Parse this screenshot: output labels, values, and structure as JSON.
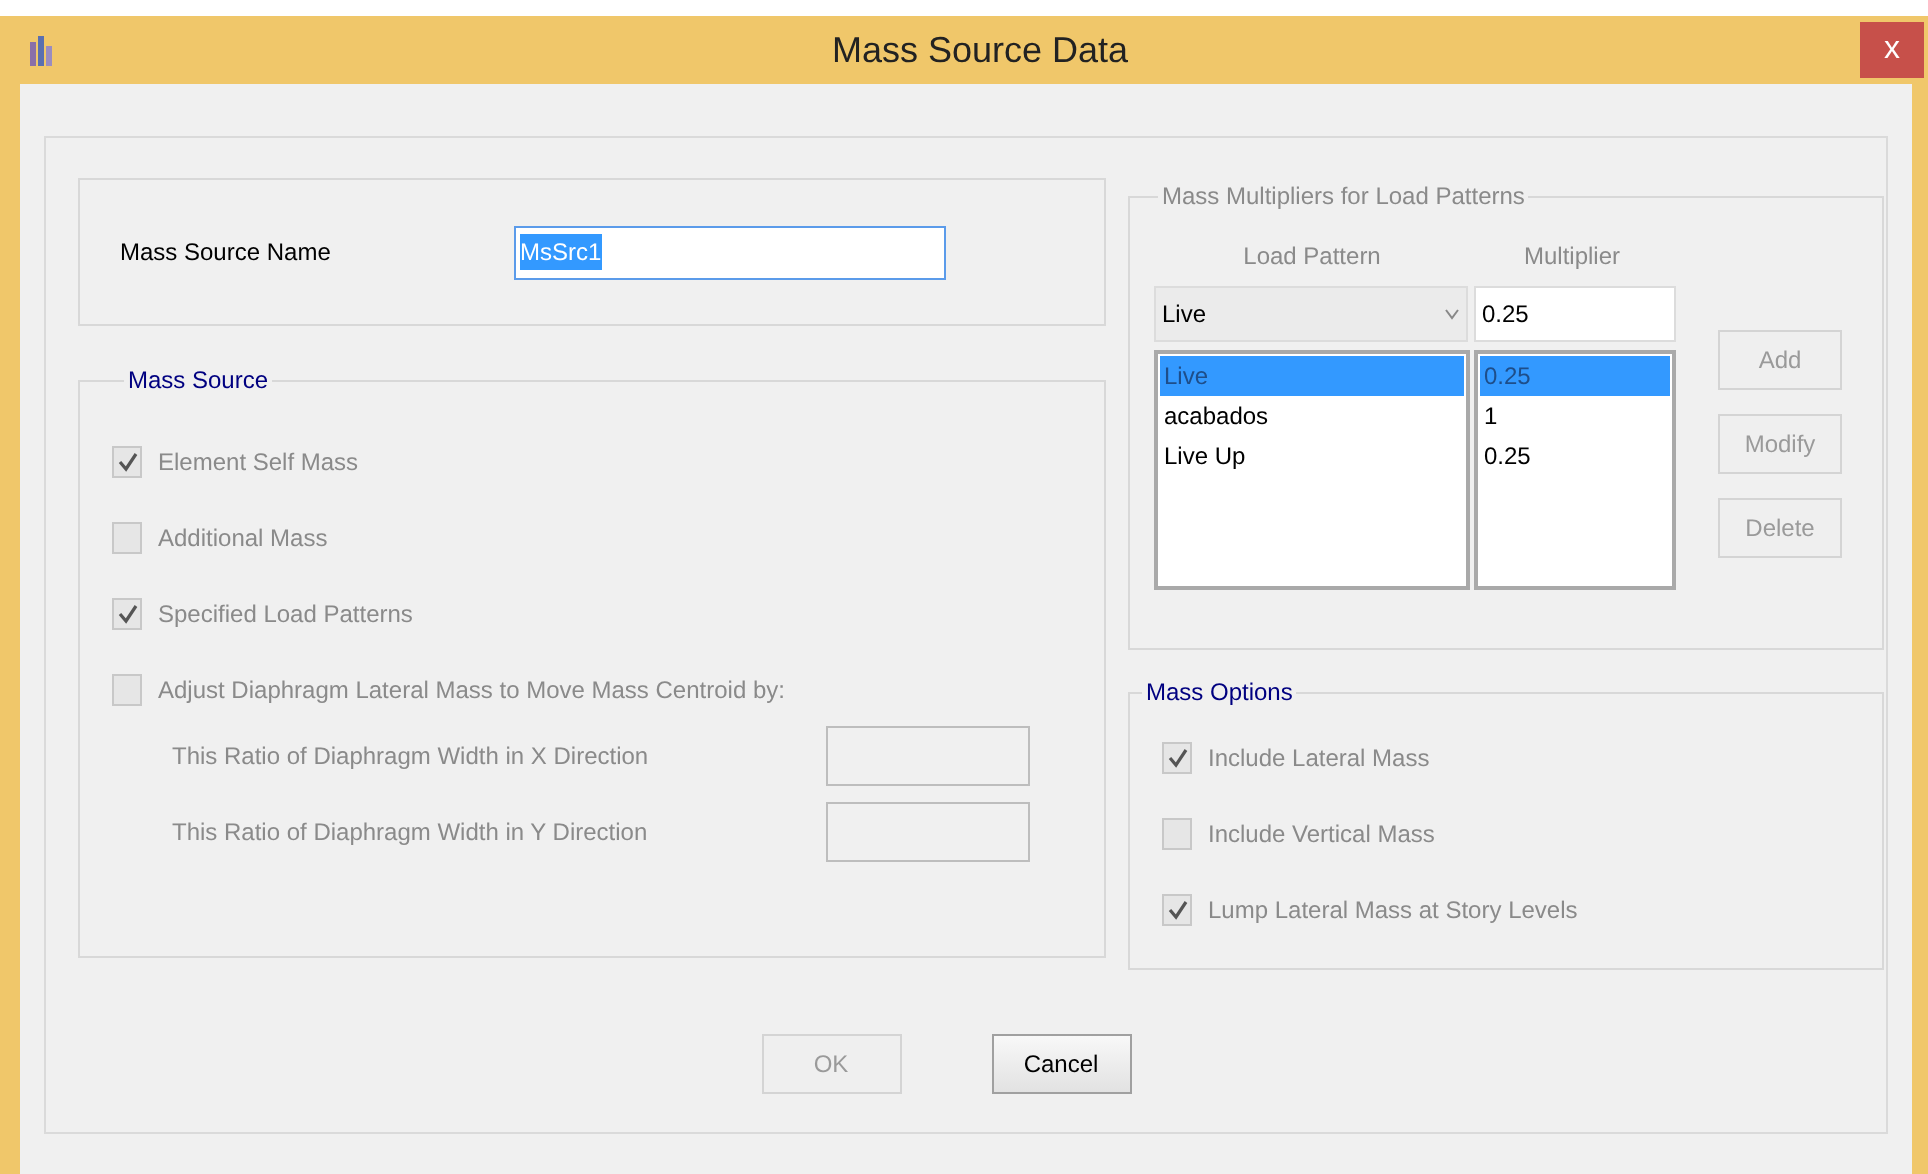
{
  "window": {
    "title": "Mass Source Data",
    "close": "x"
  },
  "name_field": {
    "label": "Mass Source Name",
    "value": "MsSrc1"
  },
  "mass_source": {
    "title": "Mass Source",
    "options": [
      {
        "label": "Element Self Mass",
        "checked": true,
        "disabled": true
      },
      {
        "label": "Additional Mass",
        "checked": false,
        "disabled": true
      },
      {
        "label": "Specified Load Patterns",
        "checked": true,
        "disabled": true
      },
      {
        "label": "Adjust Diaphragm Lateral Mass to Move Mass Centroid by:",
        "checked": false,
        "disabled": true
      }
    ],
    "ratios": [
      {
        "label": "This Ratio of Diaphragm Width in X Direction"
      },
      {
        "label": "This Ratio of Diaphragm Width in Y Direction"
      }
    ]
  },
  "multipliers": {
    "title": "Mass Multipliers for Load Patterns",
    "columns": [
      "Load Pattern",
      "Multiplier"
    ],
    "pattern_value": "Live",
    "multiplier_value": "0.25",
    "rows": [
      {
        "pattern": "Live",
        "multiplier": "0.25",
        "selected": true
      },
      {
        "pattern": "acabados",
        "multiplier": "1",
        "selected": false
      },
      {
        "pattern": "Live Up",
        "multiplier": "0.25",
        "selected": false
      }
    ],
    "buttons": [
      {
        "label": "Add",
        "disabled": true
      },
      {
        "label": "Modify",
        "disabled": true
      },
      {
        "label": "Delete",
        "disabled": true
      }
    ]
  },
  "mass_options": {
    "title": "Mass Options",
    "options": [
      {
        "label": "Include Lateral Mass",
        "checked": true,
        "disabled": true
      },
      {
        "label": "Include Vertical Mass",
        "checked": false,
        "disabled": true
      },
      {
        "label": "Lump Lateral Mass at Story Levels",
        "checked": true,
        "disabled": true
      }
    ]
  },
  "buttons": [
    {
      "label": "OK",
      "disabled": true
    },
    {
      "label": "Cancel",
      "disabled": false
    }
  ]
}
